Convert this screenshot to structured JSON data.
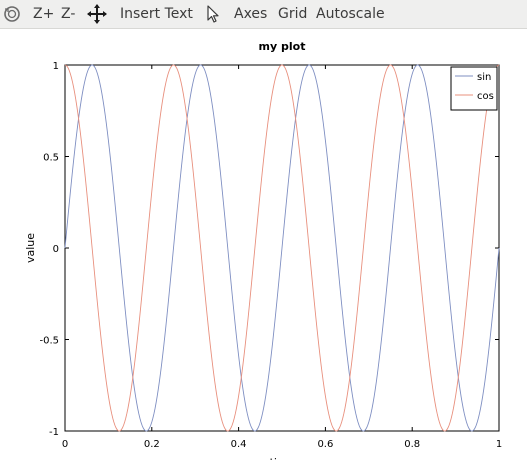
{
  "toolbar": {
    "rotate_icon": "rotate-icon",
    "zoom_in_label": "Z+",
    "zoom_out_label": "Z-",
    "pan_icon": "pan-icon",
    "insert_text_label": "Insert Text",
    "select_icon": "pointer-icon",
    "axes_label": "Axes",
    "grid_label": "Grid",
    "autoscale_label": "Autoscale"
  },
  "chart_data": {
    "type": "line",
    "title": "my plot",
    "xlabel": "time",
    "ylabel": "value",
    "xlim": [
      0,
      1
    ],
    "ylim": [
      -1,
      1
    ],
    "xticks": [
      "0",
      "0.2",
      "0.4",
      "0.6",
      "0.8",
      "1"
    ],
    "yticks": [
      "1",
      "0.5",
      "0",
      "-0.5",
      "-1"
    ],
    "grid": false,
    "legend_position": "top-right",
    "series": [
      {
        "name": "sin",
        "color": "#7f8fc2",
        "frequency": 4,
        "x": [
          0,
          0.02,
          0.04,
          0.06,
          0.08,
          0.1,
          0.12,
          0.14,
          0.16,
          0.18,
          0.2,
          0.22,
          0.24,
          0.26,
          0.28,
          0.3,
          0.32,
          0.34,
          0.36,
          0.38,
          0.4,
          0.42,
          0.44,
          0.46,
          0.48,
          0.5,
          0.52,
          0.54,
          0.56,
          0.58,
          0.6,
          0.62,
          0.64,
          0.66,
          0.68,
          0.7,
          0.72,
          0.74,
          0.76,
          0.78,
          0.8,
          0.82,
          0.84,
          0.86,
          0.88,
          0.9,
          0.92,
          0.94,
          0.96,
          0.98,
          1.0
        ],
        "values": [
          0,
          0.48,
          0.84,
          1.0,
          0.9,
          0.59,
          0.13,
          -0.37,
          -0.77,
          -0.98,
          -0.95,
          -0.68,
          -0.25,
          0.25,
          0.68,
          0.95,
          0.98,
          0.77,
          0.37,
          -0.13,
          -0.59,
          -0.9,
          -1.0,
          -0.84,
          -0.48,
          0,
          0.48,
          0.84,
          1.0,
          0.9,
          0.59,
          0.13,
          -0.37,
          -0.77,
          -0.98,
          -0.95,
          -0.68,
          -0.25,
          0.25,
          0.68,
          0.95,
          0.98,
          0.77,
          0.37,
          -0.13,
          -0.59,
          -0.9,
          -1.0,
          -0.84,
          -0.48,
          0
        ]
      },
      {
        "name": "cos",
        "color": "#e8907e",
        "frequency": 4,
        "x": [
          0,
          0.02,
          0.04,
          0.06,
          0.08,
          0.1,
          0.12,
          0.14,
          0.16,
          0.18,
          0.2,
          0.22,
          0.24,
          0.26,
          0.28,
          0.3,
          0.32,
          0.34,
          0.36,
          0.38,
          0.4,
          0.42,
          0.44,
          0.46,
          0.48,
          0.5,
          0.52,
          0.54,
          0.56,
          0.58,
          0.6,
          0.62,
          0.64,
          0.66,
          0.68,
          0.7,
          0.72,
          0.74,
          0.76,
          0.78,
          0.8,
          0.82,
          0.84,
          0.86,
          0.88,
          0.9,
          0.92,
          0.94,
          0.96,
          0.98,
          1.0
        ],
        "values": [
          1.0,
          0.88,
          0.54,
          0.07,
          -0.42,
          -0.81,
          -0.99,
          -0.93,
          -0.64,
          -0.19,
          0.31,
          0.73,
          0.97,
          0.97,
          0.73,
          0.31,
          -0.19,
          -0.64,
          -0.93,
          -0.99,
          -0.81,
          -0.42,
          0.07,
          0.54,
          0.88,
          1.0,
          0.88,
          0.54,
          0.07,
          -0.42,
          -0.81,
          -0.99,
          -0.93,
          -0.64,
          -0.19,
          0.31,
          0.73,
          0.97,
          0.97,
          0.73,
          0.31,
          -0.19,
          -0.64,
          -0.93,
          -0.99,
          -0.81,
          -0.42,
          0.07,
          0.54,
          0.88,
          1.0
        ]
      }
    ]
  }
}
